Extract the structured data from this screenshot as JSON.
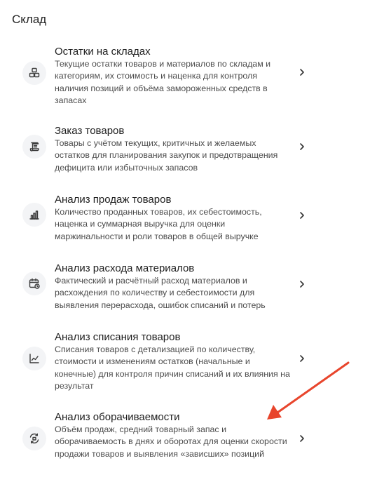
{
  "section": {
    "title": "Склад"
  },
  "annotation": {
    "arrow_color": "#e8452c"
  },
  "items": [
    {
      "title": "Остатки на складах",
      "description": "Текущие остатки товаров и материалов по складам и категориям, их стоимость и наценка для контроля наличия позиций и объёма замороженных средств в запасах",
      "icon": "boxes-icon"
    },
    {
      "title": "Заказ товаров",
      "description": "Товары с учётом текущих, критичных и желаемых остатков для планирования закупок и предотвращения дефицита или избыточных запасов",
      "icon": "scroll-icon"
    },
    {
      "title": "Анализ продаж товаров",
      "description": "Количество проданных товаров, их себестоимость, наценка и суммарная выручка для оценки маржинальности и роли товаров в общей выручке",
      "icon": "bar-chart-icon"
    },
    {
      "title": "Анализ расхода материалов",
      "description": "Фактический и расчётный расход материалов и расхождения по количеству и себестоимости для выявления перерасхода, ошибок списаний и потерь",
      "icon": "calendar-clock-icon"
    },
    {
      "title": "Анализ списания товаров",
      "description": "Списания товаров с детализацией по количеству, стоимости и изменениям остатков (начальные и конечные) для контроля причин списаний и их влияния на результат",
      "icon": "line-chart-icon"
    },
    {
      "title": "Анализ оборачиваемости",
      "description": "Объём продаж, средний товарный запас и оборачиваемость в днях и оборотах для оценки скорости продажи товаров и выявления «зависших» позиций",
      "icon": "turnover-icon"
    }
  ]
}
